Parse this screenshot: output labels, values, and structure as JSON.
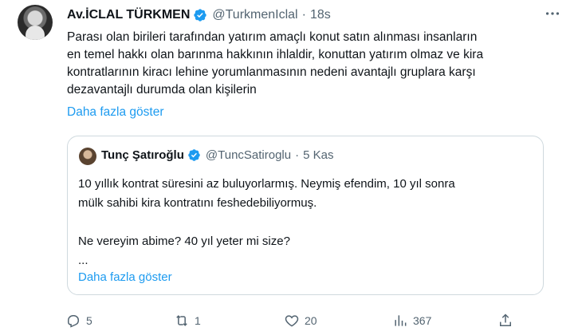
{
  "tweet": {
    "author_name": "Av.İCLAL TÜRKMEN",
    "handle": "@TurkmenIclal",
    "separator": "·",
    "time": "18s",
    "text": "Parası olan birileri tarafından yatırım amaçlı konut  satın alınması insanların\nen temel hakkı olan barınma hakkının ihlaldir, konuttan yatırım olmaz ve kira\nkontratlarının kiracı lehine yorumlanmasının nedeni avantajlı gruplara karşı\ndezavantajlı  durumda olan kişilerin",
    "show_more": "Daha fazla göster"
  },
  "quote": {
    "author_name": "Tunç Şatıroğlu",
    "handle": "@TuncSatiroglu",
    "separator": "·",
    "time": "5 Kas",
    "text": "10 yıllık kontrat süresini az buluyorlarmış. Neymiş efendim, 10 yıl sonra\nmülk sahibi kira kontratını feshedebiliyormuş.\n\nNe vereyim abime? 40 yıl yeter mi size?\n...",
    "show_more": "Daha fazla göster"
  },
  "actions": {
    "replies": "5",
    "retweets": "1",
    "likes": "20",
    "views": "367"
  },
  "icons": {
    "verified": "verified-badge-icon",
    "more": "more-options-icon",
    "reply": "reply-icon",
    "retweet": "retweet-icon",
    "like": "heart-icon",
    "views": "views-icon",
    "share": "share-icon"
  },
  "colors": {
    "link": "#1d9bf0",
    "muted": "#536471",
    "border": "#cfd9de",
    "text": "#0f1419"
  }
}
